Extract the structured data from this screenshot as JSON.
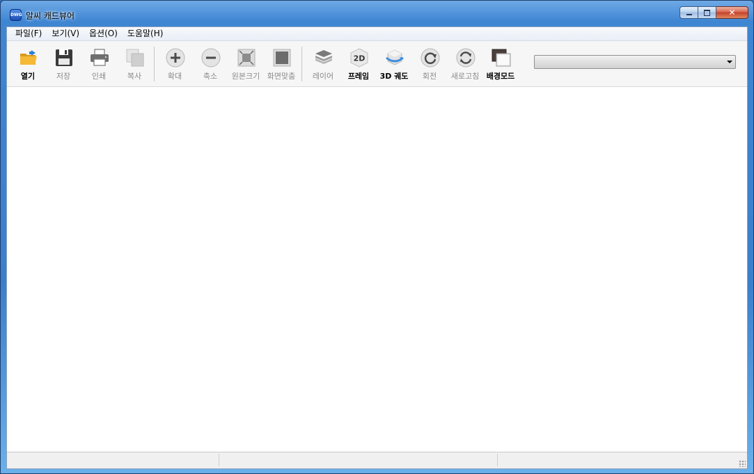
{
  "window": {
    "title": "알씨 캐드뷰어",
    "app_icon_text": "DWG",
    "close_glyph": "✕"
  },
  "menu": [
    "파일(F)",
    "보기(V)",
    "옵션(O)",
    "도움말(H)"
  ],
  "toolbar": {
    "buttons": [
      {
        "label": "열기",
        "icon": "open-folder-icon",
        "enabled": true
      },
      {
        "label": "저장",
        "icon": "save-disk-icon",
        "enabled": false
      },
      {
        "label": "인쇄",
        "icon": "printer-icon",
        "enabled": false
      },
      {
        "label": "복사",
        "icon": "copy-icon",
        "enabled": false
      },
      {
        "label": "확대",
        "icon": "zoom-in-icon",
        "enabled": false
      },
      {
        "label": "축소",
        "icon": "zoom-out-icon",
        "enabled": false
      },
      {
        "label": "원본크기",
        "icon": "original-size-icon",
        "enabled": false
      },
      {
        "label": "화면맞춤",
        "icon": "fit-screen-icon",
        "enabled": false
      },
      {
        "label": "레이어",
        "icon": "layers-icon",
        "enabled": false
      },
      {
        "label": "프레임",
        "icon": "2d-frame-icon",
        "icon_text": "2D",
        "enabled": true
      },
      {
        "label": "3D 궤도",
        "icon": "3d-orbit-icon",
        "enabled": true
      },
      {
        "label": "회전",
        "icon": "rotate-icon",
        "enabled": false
      },
      {
        "label": "새로고침",
        "icon": "refresh-icon",
        "enabled": false
      },
      {
        "label": "배경모드",
        "icon": "background-mode-icon",
        "enabled": true
      }
    ],
    "combo_value": ""
  },
  "colors": {
    "enabled_label": "#000000",
    "disabled_label": "#8a8a8a",
    "folder": "#f2b233",
    "orbit_blue": "#3b8de0"
  }
}
